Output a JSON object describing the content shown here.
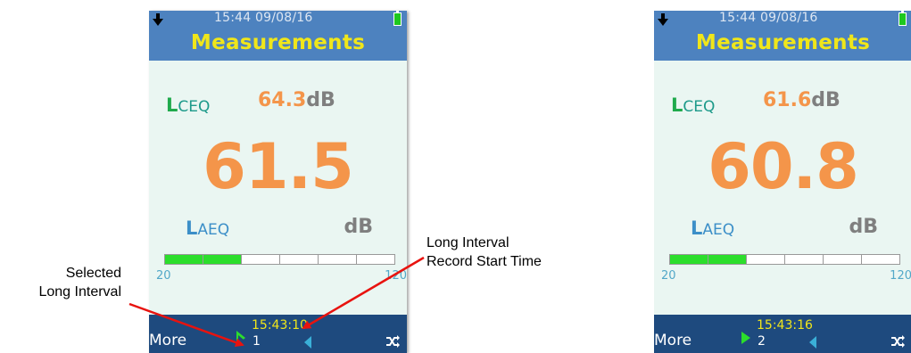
{
  "colors": {
    "header_blue": "#4d82bf",
    "title_yellow": "#f0e61a",
    "value_orange": "#f4954a",
    "screen_bg": "#eaf6f2",
    "bar_green": "#2cde2c",
    "footer_navy": "#1e4a7e",
    "annotation_arrow_red": "#e8130f"
  },
  "screens": [
    {
      "status_time": "15:44  09/08/16",
      "title": "Measurements",
      "lceq": {
        "letter": "L",
        "subscript": "CEQ",
        "value": "64.3",
        "unit": "dB"
      },
      "main_value": "61.5",
      "laeq": {
        "letter": "L",
        "subscript": "AEQ",
        "unit": "dB"
      },
      "level_bar": {
        "min": "20",
        "max": "120",
        "filled_segments": 2,
        "total_segments": 6
      },
      "footer": {
        "more_label": "More",
        "interval_time": "15:43:10",
        "interval_number": "1",
        "marker_icon": "green-triangle-selected",
        "back_icon": "left-arrow-icon",
        "shuffle_icon": "shuffle-icon"
      }
    },
    {
      "status_time": "15:44  09/08/16",
      "title": "Measurements",
      "lceq": {
        "letter": "L",
        "subscript": "CEQ",
        "value": "61.6",
        "unit": "dB"
      },
      "main_value": "60.8",
      "laeq": {
        "letter": "L",
        "subscript": "AEQ",
        "unit": "dB"
      },
      "level_bar": {
        "min": "20",
        "max": "120",
        "filled_segments": 2,
        "total_segments": 6
      },
      "footer": {
        "more_label": "More",
        "interval_time": "15:43:16",
        "interval_number": "2",
        "marker_icon": "green-triangle-play",
        "back_icon": "left-arrow-icon",
        "shuffle_icon": "shuffle-icon"
      }
    }
  ],
  "annotations": {
    "selected_interval": [
      "Selected",
      "Long Interval"
    ],
    "record_start": [
      "Long Interval",
      "Record Start Time"
    ]
  }
}
